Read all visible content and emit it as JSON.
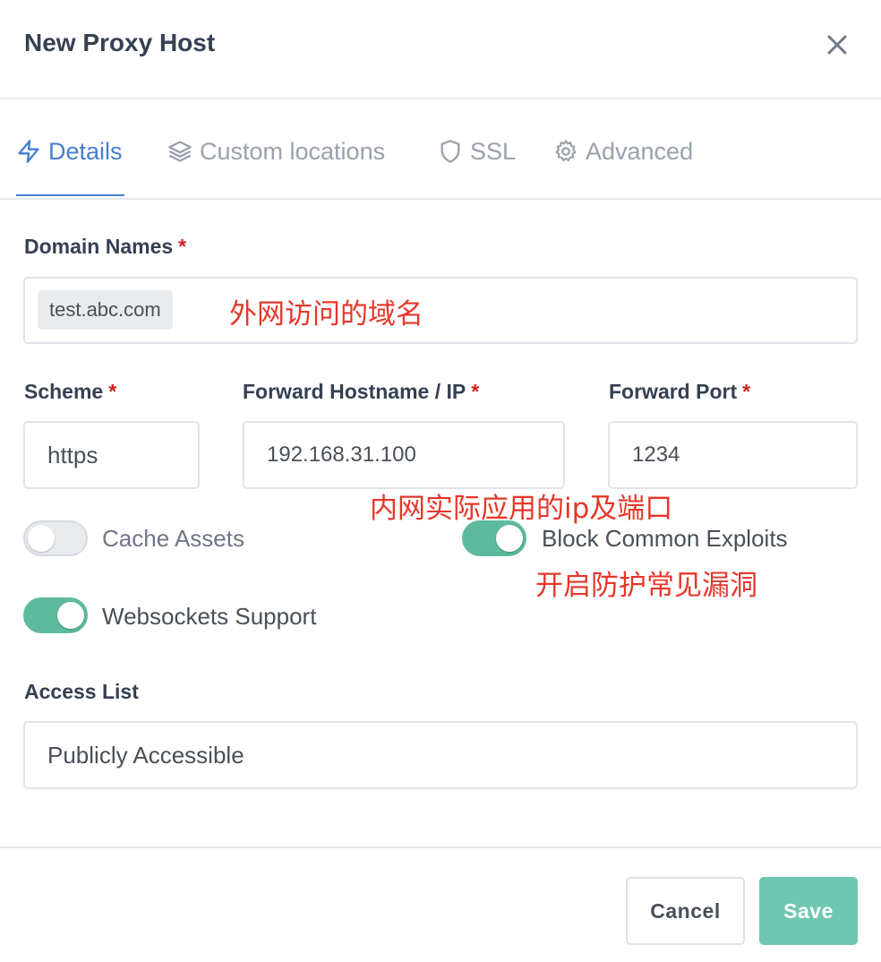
{
  "header": {
    "title": "New Proxy Host"
  },
  "tabs": [
    {
      "label": "Details",
      "icon": "bolt-icon",
      "active": true
    },
    {
      "label": "Custom locations",
      "icon": "layers-icon",
      "active": false
    },
    {
      "label": "SSL",
      "icon": "shield-icon",
      "active": false
    },
    {
      "label": "Advanced",
      "icon": "gear-icon",
      "active": false
    }
  ],
  "form": {
    "domain_names": {
      "label": "Domain Names",
      "required_mark": "*",
      "tags": [
        "test.abc.com"
      ]
    },
    "scheme": {
      "label": "Scheme",
      "required_mark": "*",
      "value": "https"
    },
    "forward_host": {
      "label": "Forward Hostname / IP",
      "required_mark": "*",
      "value": "192.168.31.100"
    },
    "forward_port": {
      "label": "Forward Port",
      "required_mark": "*",
      "value": "1234"
    },
    "toggles": {
      "cache_assets": {
        "label": "Cache Assets",
        "on": false
      },
      "block_exploits": {
        "label": "Block Common Exploits",
        "on": true
      },
      "websockets": {
        "label": "Websockets Support",
        "on": true
      }
    },
    "access_list": {
      "label": "Access List",
      "value": "Publicly Accessible"
    }
  },
  "annotations": {
    "domain_note": "外网访问的域名",
    "ip_note": "内网实际应用的ip及端口",
    "exploit_note": "开启防护常见漏洞"
  },
  "footer": {
    "cancel_label": "Cancel",
    "save_label": "Save"
  },
  "colors": {
    "accent": "#467fcf",
    "toggle_on": "#5eba9f",
    "save_button": "#6fc7b1",
    "required": "#cd201f",
    "annotation": "#e8362a"
  }
}
